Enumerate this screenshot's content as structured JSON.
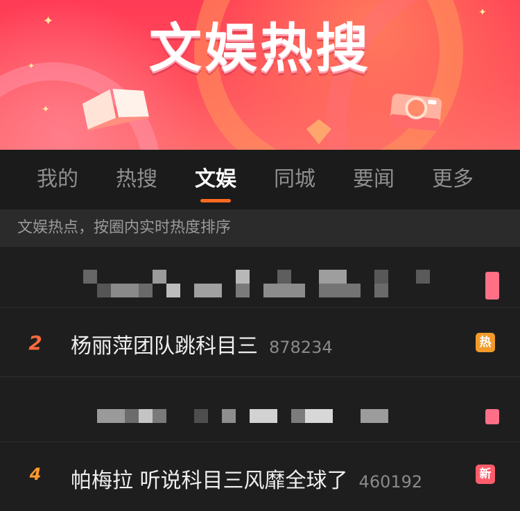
{
  "banner": {
    "title": "文娱热搜"
  },
  "tabs": [
    {
      "label": "我的"
    },
    {
      "label": "热搜"
    },
    {
      "label": "文娱"
    },
    {
      "label": "同城"
    },
    {
      "label": "要闻"
    },
    {
      "label": "更多"
    }
  ],
  "active_tab": "文娱",
  "subtitle": "文娱热点，按圈内实时热度排序",
  "items": [
    {
      "rank": "2",
      "title": "杨丽萍团队跳科目三",
      "count": "878234",
      "badge": "热",
      "badge_color": "#f29a2a",
      "rank_color": "#ff6a3d"
    },
    {
      "rank": "4",
      "title": "帕梅拉 听说科目三风靡全球了",
      "count": "460192",
      "badge": "新",
      "badge_color": "#ff5d6c",
      "rank_color": "#ff9a2e"
    }
  ],
  "colors": {
    "accent": "#ff6a22",
    "banner_red": "#ff3b55",
    "background": "#1b1b1b"
  }
}
